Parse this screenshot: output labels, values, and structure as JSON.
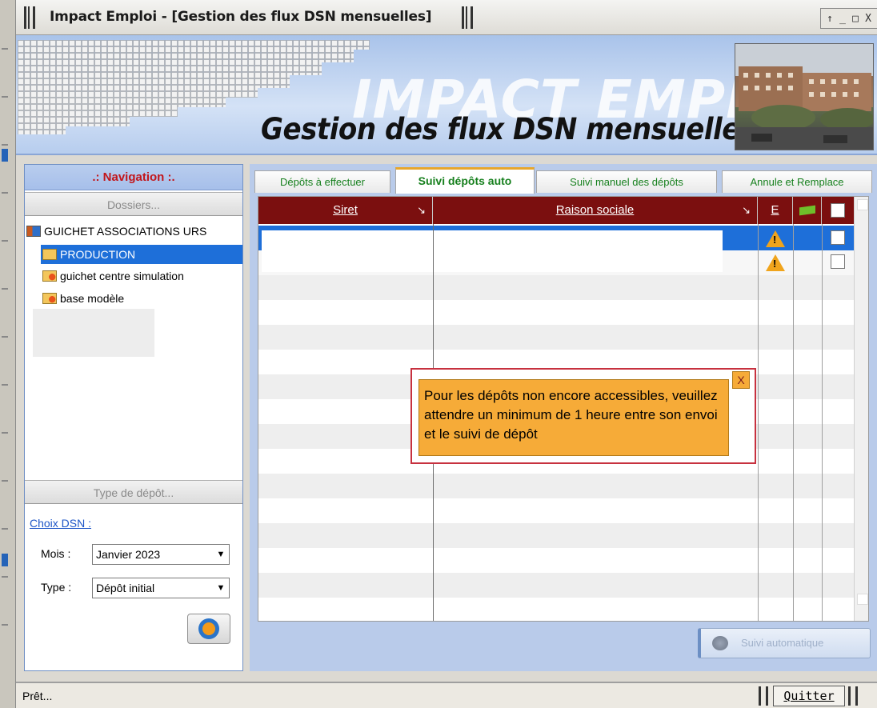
{
  "window": {
    "title": "Impact Emploi - [Gestion des flux DSN mensuelles]",
    "controls": [
      "↑",
      "_",
      "□",
      "X"
    ]
  },
  "banner": {
    "watermark": "IMPACT EMPLOI",
    "subtitle": "Gestion des flux DSN mensuelles"
  },
  "nav": {
    "header": ".: Navigation :.",
    "dossiers_label": "Dossiers...",
    "tree": [
      {
        "label": "GUICHET ASSOCIATIONS URS",
        "level": 0,
        "selected": false,
        "icon": "building-icon"
      },
      {
        "label": "PRODUCTION",
        "level": 1,
        "selected": true,
        "icon": "folder-edit-icon"
      },
      {
        "label": "guichet centre simulation",
        "level": 1,
        "selected": false,
        "icon": "folder-warning-icon"
      },
      {
        "label": "base modèle",
        "level": 1,
        "selected": false,
        "icon": "folder-warning-icon"
      }
    ],
    "type_depot_label": "Type de dépôt...",
    "choix_label": "Choix DSN :",
    "mois_label": "Mois :",
    "mois_value": "Janvier 2023",
    "type_label": "Type :",
    "type_value": "Dépôt initial"
  },
  "tabs": [
    {
      "label": "Dépôts à effectuer",
      "active": false
    },
    {
      "label": "Suivi dépôts auto",
      "active": true
    },
    {
      "label": "Suivi manuel des dépôts",
      "active": false
    },
    {
      "label": "Annule et Remplace",
      "active": false
    }
  ],
  "grid": {
    "columns": {
      "siret": "Siret",
      "raison": "Raison sociale",
      "e": "E",
      "flag": "",
      "check": ""
    },
    "rows": [
      {
        "siret": "",
        "raison": "",
        "warning": true,
        "checked": false,
        "selected": true
      },
      {
        "siret": "",
        "raison": "",
        "warning": true,
        "checked": false,
        "selected": false
      }
    ]
  },
  "tooltip": {
    "text": "Pour les dépôts non encore accessibles, veuillez attendre un minimum de 1 heure entre son envoi et le suivi de dépôt",
    "close": "X"
  },
  "actions": {
    "suivi_auto": "Suivi automatique"
  },
  "status": {
    "text": "Prêt...",
    "quit": "Quitter"
  },
  "colors": {
    "grid_header": "#7b0f0f",
    "selection": "#1e6fd9",
    "tooltip_bg": "#f6ab38",
    "nav_header_text": "#c2161b",
    "tab_text": "#17801e"
  }
}
